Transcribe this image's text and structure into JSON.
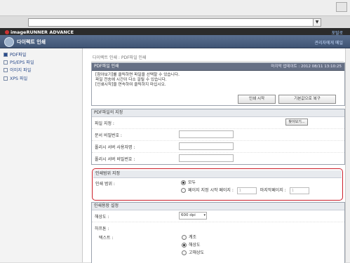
{
  "browser": {
    "dropdown_glyph": "▼"
  },
  "header": {
    "brand": "imageRUNNER ADVANCE",
    "home_link": "포털로"
  },
  "titlebar": {
    "title": "다이렉트 인쇄",
    "admin_link": "관리자에게 메일"
  },
  "sidebar": {
    "items": [
      {
        "label": "PDF파일",
        "active": true
      },
      {
        "label": "PS/EPS 파일",
        "active": false
      },
      {
        "label": "이미지 파일",
        "active": false
      },
      {
        "label": "XPS 파일",
        "active": false
      }
    ]
  },
  "main": {
    "breadcrumb": "다이렉트 인쇄 : PDF파일 인쇄",
    "print_section": {
      "title": "PDF파일 인쇄",
      "last_updated": "마지막 업데이트 : 2012 08/11 13:10:25",
      "messages": [
        "[참아보기]를 클릭하면 파일을 선택할 수 있습니다.",
        "파일 전송에 시간이 다소 걸릴 수 있습니다.",
        "[인쇄시작]을 연속하여 클릭하지 마십시오."
      ],
      "start_button": "인쇄 시작",
      "reset_button": "기본값으로 복구"
    },
    "file_section": {
      "title": "PDF파일의 지정",
      "browse_button": "찾아보기...",
      "fields": [
        {
          "label": "파일 지정 :"
        },
        {
          "label": "문서 비밀번호 :"
        },
        {
          "label": "폴리시 서버 사용자명 :"
        },
        {
          "label": "폴리시 서버 비밀번호 :"
        }
      ]
    },
    "range_section": {
      "title": "인쇄범위 지정",
      "label": "인쇄 범위 :",
      "option_all": "모두",
      "option_pages": "페이지 지정",
      "start_page_label": "시작 페이지 :",
      "start_page_value": "1",
      "end_page_label": "마지막페이지 :",
      "end_page_value": "1"
    },
    "settings_section": {
      "title": "인쇄용장 설정",
      "resolution_label": "해상도 :",
      "resolution_value": "600 dpi",
      "halftone_label": "하프톤 :",
      "text_label": "텍스트 :",
      "options": [
        {
          "label": "계조",
          "selected": false
        },
        {
          "label": "해상도",
          "selected": true
        },
        {
          "label": "고해상도",
          "selected": false
        }
      ]
    }
  }
}
